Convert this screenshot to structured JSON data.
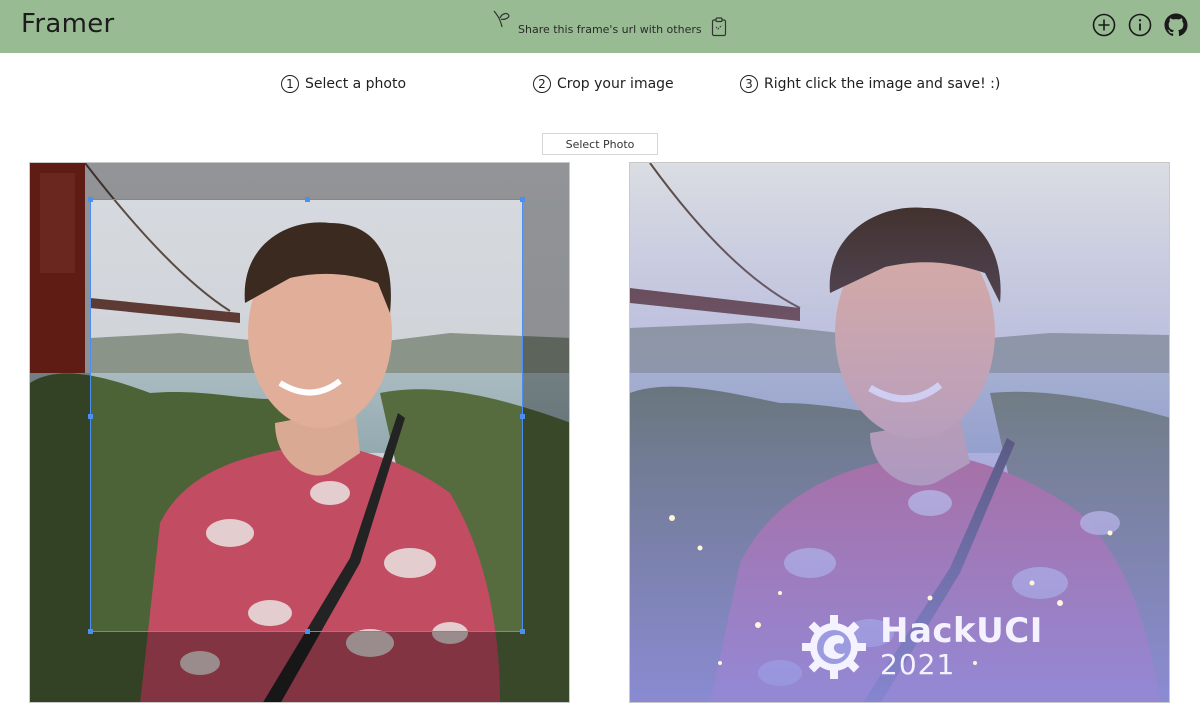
{
  "header": {
    "brand": "Framer",
    "share_text": "Share this frame's url with others",
    "icons": [
      "sprout-icon",
      "clipboard-icon",
      "add-circle-icon",
      "info-icon",
      "github-icon"
    ]
  },
  "steps": [
    {
      "num": "1",
      "label": "Select a photo"
    },
    {
      "num": "2",
      "label": "Crop your image"
    },
    {
      "num": "3",
      "label": "Right click the image and save! :)"
    }
  ],
  "select_button": "Select Photo",
  "frame_overlay": {
    "line1": "HackUCI",
    "line2": "2021"
  },
  "colors": {
    "header_bg": "#99bb94",
    "crop_accent": "#4d8ff0",
    "frame_tint": "#8f8ee0"
  }
}
